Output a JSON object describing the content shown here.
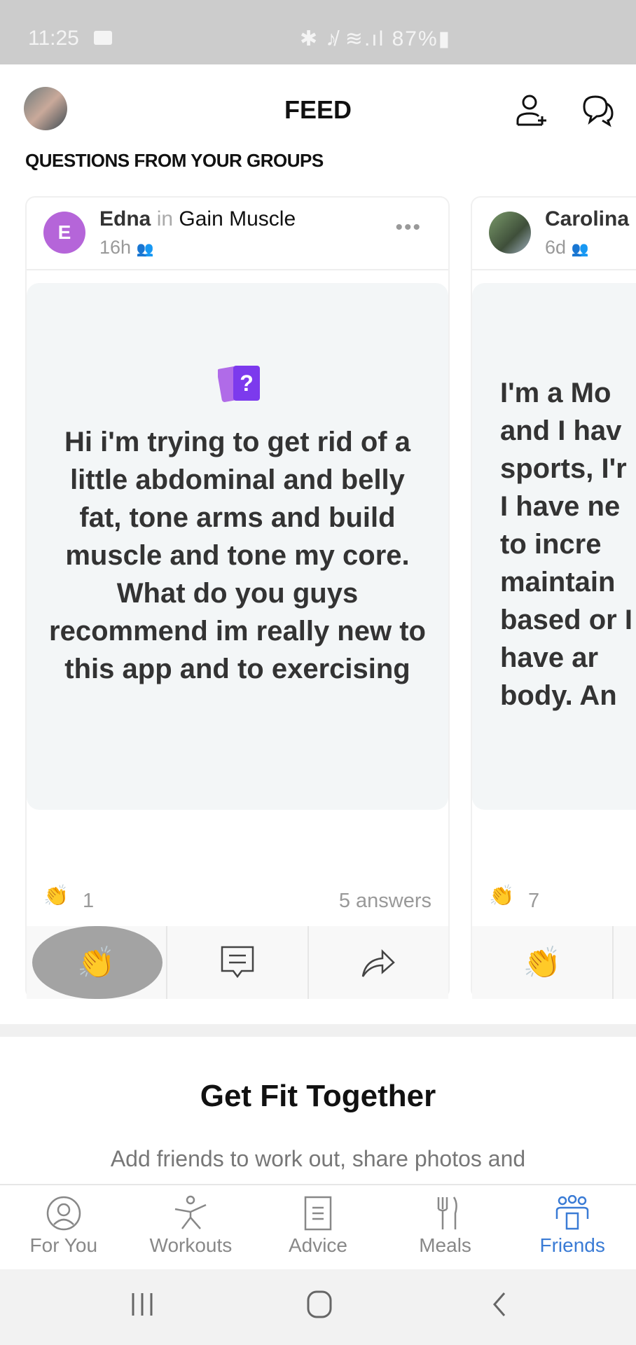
{
  "status": {
    "time": "11:25",
    "icons": "✱ ♪̸ ≋.ıl 87%▮"
  },
  "header": {
    "title": "FEED"
  },
  "section_title": "QUESTIONS FROM YOUR GROUPS",
  "cards": [
    {
      "author": "Edna",
      "in": "in",
      "group": "Gain Muscle",
      "time": "16h",
      "avatar_letter": "E",
      "avatar_color": "#b565d9",
      "question": "Hi i'm trying to get rid of a little abdominal and belly fat, tone arms and build muscle and tone my core. What do you guys recommend im really new to this app and to exercising",
      "claps": "1",
      "answers": "5 answers"
    },
    {
      "author": "Carolina",
      "time": "6d",
      "question": "I'm a Mo and I hav sports, I'r I have ne to incre maintain based or I have ar body. An",
      "claps": "7"
    }
  ],
  "promo": {
    "title": "Get Fit Together",
    "subtitle": "Add friends to work out, share photos and"
  },
  "nav": [
    {
      "label": "For You"
    },
    {
      "label": "Workouts"
    },
    {
      "label": "Advice"
    },
    {
      "label": "Meals"
    },
    {
      "label": "Friends",
      "active": true
    }
  ],
  "colors": {
    "accent": "#3a7bd5",
    "question_icon": "#8e44e8"
  }
}
